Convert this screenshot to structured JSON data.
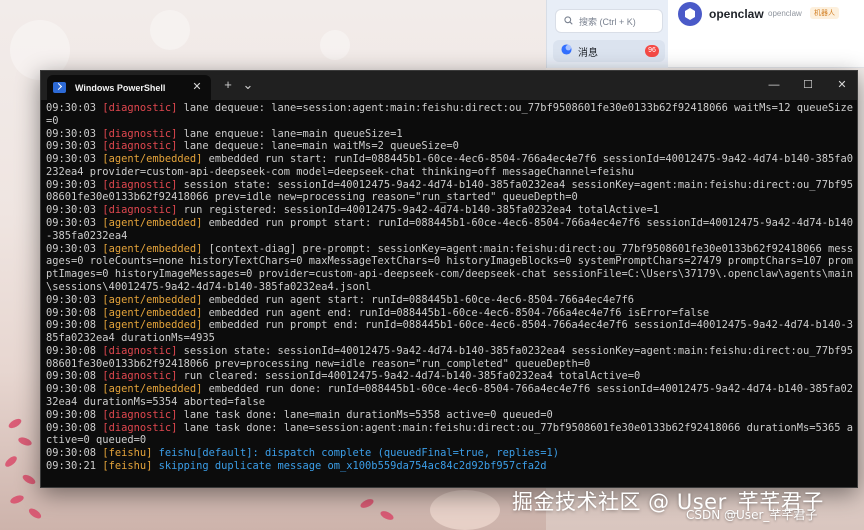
{
  "feishu": {
    "search_placeholder": "搜索 (Ctrl + K)",
    "messages_label": "消息",
    "messages_badge": "96",
    "chat_name": "openclaw",
    "chat_handle": "openclaw",
    "chat_tag": "机器人"
  },
  "powershell": {
    "tab_title": "Windows PowerShell",
    "new_tab": "+",
    "dropdown": "⌄",
    "lines": [
      [
        {
          "t": "09:30:03 "
        },
        {
          "t": "[diagnostic]",
          "c": "t-diag"
        },
        {
          "t": " lane dequeue: lane=session:agent:main:feishu:direct:ou_77bf9508601fe30e0133b62f92418066 waitMs=12 queueSize=0"
        }
      ],
      [
        {
          "t": "09:30:03 "
        },
        {
          "t": "[diagnostic]",
          "c": "t-diag"
        },
        {
          "t": " lane enqueue: lane=main queueSize=1"
        }
      ],
      [
        {
          "t": "09:30:03 "
        },
        {
          "t": "[diagnostic]",
          "c": "t-diag"
        },
        {
          "t": " lane dequeue: lane=main waitMs=2 queueSize=0"
        }
      ],
      [
        {
          "t": "09:30:03 "
        },
        {
          "t": "[agent/embedded]",
          "c": "t-agent"
        },
        {
          "t": " embedded run start: runId=088445b1-60ce-4ec6-8504-766a4ec4e7f6 sessionId=40012475-9a42-4d74-b140-385fa0232ea4 provider=custom-api-deepseek-com model=deepseek-chat thinking=off messageChannel=feishu"
        }
      ],
      [
        {
          "t": "09:30:03 "
        },
        {
          "t": "[diagnostic]",
          "c": "t-diag"
        },
        {
          "t": " session state: sessionId=40012475-9a42-4d74-b140-385fa0232ea4 sessionKey=agent:main:feishu:direct:ou_77bf9508601fe30e0133b62f92418066 prev=idle new=processing reason=\"run_started\" queueDepth=0"
        }
      ],
      [
        {
          "t": "09:30:03 "
        },
        {
          "t": "[diagnostic]",
          "c": "t-diag"
        },
        {
          "t": " run registered: sessionId=40012475-9a42-4d74-b140-385fa0232ea4 totalActive=1"
        }
      ],
      [
        {
          "t": "09:30:03 "
        },
        {
          "t": "[agent/embedded]",
          "c": "t-agent"
        },
        {
          "t": " embedded run prompt start: runId=088445b1-60ce-4ec6-8504-766a4ec4e7f6 sessionId=40012475-9a42-4d74-b140-385fa0232ea4"
        }
      ],
      [
        {
          "t": "09:30:03 "
        },
        {
          "t": "[agent/embedded]",
          "c": "t-agent"
        },
        {
          "t": " [context-diag] pre-prompt: sessionKey=agent:main:feishu:direct:ou_77bf9508601fe30e0133b62f92418066 messages=0 roleCounts=none historyTextChars=0 maxMessageTextChars=0 historyImageBlocks=0 systemPromptChars=27479 promptChars=107 promptImages=0 historyImageMessages=0 provider=custom-api-deepseek-com/deepseek-chat sessionFile=C:\\Users\\37179\\.openclaw\\agents\\main\\sessions\\40012475-9a42-4d74-b140-385fa0232ea4.jsonl"
        }
      ],
      [
        {
          "t": "09:30:03 "
        },
        {
          "t": "[agent/embedded]",
          "c": "t-agent"
        },
        {
          "t": " embedded run agent start: runId=088445b1-60ce-4ec6-8504-766a4ec4e7f6"
        }
      ],
      [
        {
          "t": "09:30:08 "
        },
        {
          "t": "[agent/embedded]",
          "c": "t-agent"
        },
        {
          "t": " embedded run agent end: runId=088445b1-60ce-4ec6-8504-766a4ec4e7f6 isError=false"
        }
      ],
      [
        {
          "t": "09:30:08 "
        },
        {
          "t": "[agent/embedded]",
          "c": "t-agent"
        },
        {
          "t": " embedded run prompt end: runId=088445b1-60ce-4ec6-8504-766a4ec4e7f6 sessionId=40012475-9a42-4d74-b140-385fa0232ea4 durationMs=4935"
        }
      ],
      [
        {
          "t": "09:30:08 "
        },
        {
          "t": "[diagnostic]",
          "c": "t-diag"
        },
        {
          "t": " session state: sessionId=40012475-9a42-4d74-b140-385fa0232ea4 sessionKey=agent:main:feishu:direct:ou_77bf9508601fe30e0133b62f92418066 prev=processing new=idle reason=\"run_completed\" queueDepth=0"
        }
      ],
      [
        {
          "t": "09:30:08 "
        },
        {
          "t": "[diagnostic]",
          "c": "t-diag"
        },
        {
          "t": " run cleared: sessionId=40012475-9a42-4d74-b140-385fa0232ea4 totalActive=0"
        }
      ],
      [
        {
          "t": "09:30:08 "
        },
        {
          "t": "[agent/embedded]",
          "c": "t-agent"
        },
        {
          "t": " embedded run done: runId=088445b1-60ce-4ec6-8504-766a4ec4e7f6 sessionId=40012475-9a42-4d74-b140-385fa0232ea4 durationMs=5354 aborted=false"
        }
      ],
      [
        {
          "t": "09:30:08 "
        },
        {
          "t": "[diagnostic]",
          "c": "t-diag"
        },
        {
          "t": " lane task done: lane=main durationMs=5358 active=0 queued=0"
        }
      ],
      [
        {
          "t": "09:30:08 "
        },
        {
          "t": "[diagnostic]",
          "c": "t-diag"
        },
        {
          "t": " lane task done: lane=session:agent:main:feishu:direct:ou_77bf9508601fe30e0133b62f92418066 durationMs=5365 active=0 queued=0"
        }
      ],
      [
        {
          "t": "09:30:08 "
        },
        {
          "t": "[feishu]",
          "c": "t-feishu"
        },
        {
          "t": " feishu[default]: dispatch complete (queuedFinal=true, replies=1)",
          "c": "blue"
        }
      ],
      [
        {
          "t": "09:30:21 "
        },
        {
          "t": "[feishu]",
          "c": "t-feishu"
        },
        {
          "t": " skipping duplicate message om_x100b559da754ac84c2d92bf957cfa2d",
          "c": "blue"
        }
      ]
    ]
  },
  "watermark": {
    "main": "掘金技术社区 @ User_芊芊君子",
    "sub": "CSDN @User_芊芊君子"
  }
}
